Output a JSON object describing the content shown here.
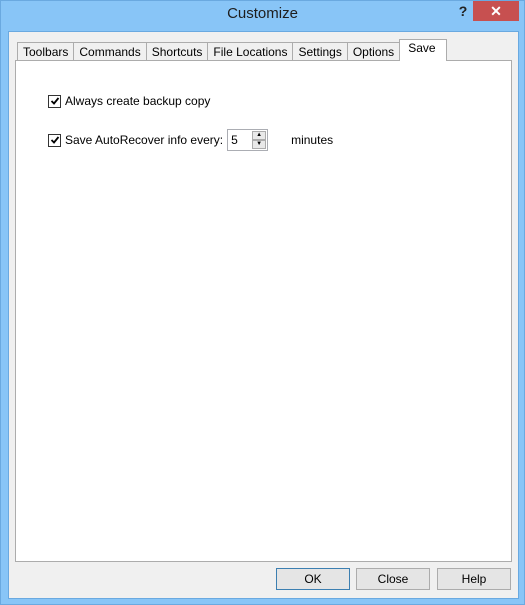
{
  "window": {
    "title": "Customize",
    "help_glyph": "?",
    "close_glyph": "✕"
  },
  "tabs": [
    {
      "label": "Toolbars",
      "active": false
    },
    {
      "label": "Commands",
      "active": false
    },
    {
      "label": "Shortcuts",
      "active": false
    },
    {
      "label": "File Locations",
      "active": false
    },
    {
      "label": "Settings",
      "active": false
    },
    {
      "label": "Options",
      "active": false
    },
    {
      "label": "Save",
      "active": true
    }
  ],
  "save_tab": {
    "backup": {
      "label": "Always create backup copy",
      "checked": true
    },
    "autorecover": {
      "label": "Save AutoRecover info every:",
      "checked": true,
      "value": "5",
      "unit": "minutes"
    }
  },
  "buttons": {
    "ok": "OK",
    "close": "Close",
    "help": "Help"
  }
}
